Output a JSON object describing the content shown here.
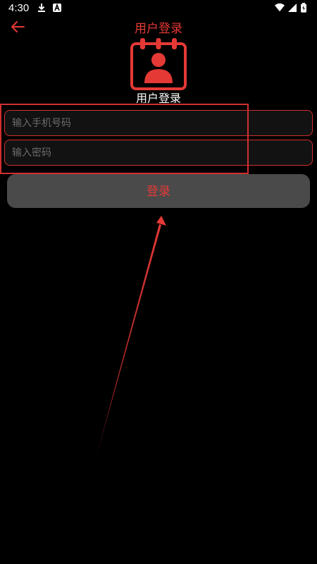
{
  "status_bar": {
    "time": "4:30",
    "icons": [
      "download-icon",
      "a-badge-icon",
      "wifi-icon",
      "signal-icon",
      "battery-icon"
    ]
  },
  "header": {
    "back_icon": "arrow-left-icon",
    "title": "用户登录"
  },
  "avatar": {
    "icon": "user-calendar-icon",
    "caption": "用户登录"
  },
  "form": {
    "phone_placeholder": "输入手机号码",
    "password_placeholder": "输入密码",
    "login_label": "登录"
  },
  "colors": {
    "accent": "#e53935",
    "background": "#000000",
    "button_bg": "#4a4a4a",
    "field_border": "#d32f2f"
  }
}
